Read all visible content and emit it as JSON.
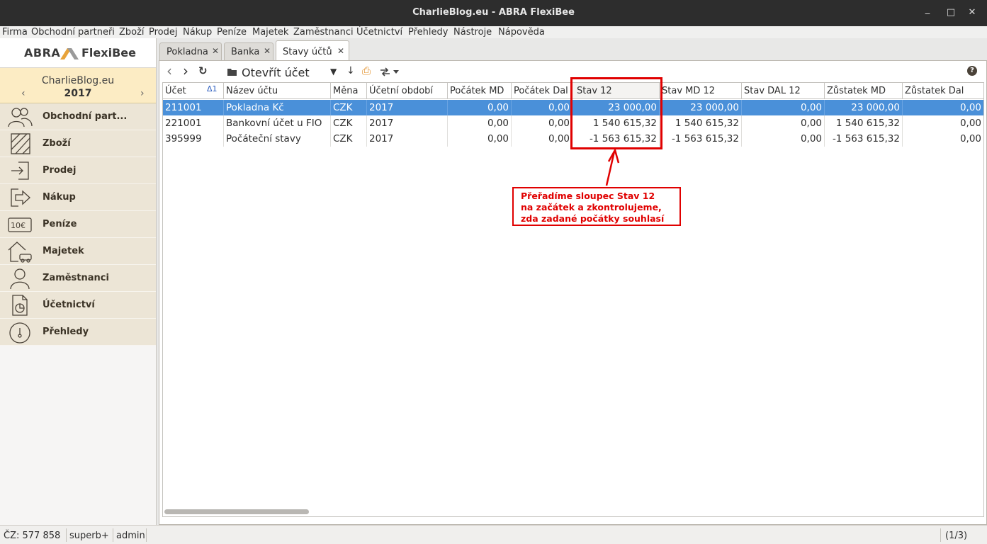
{
  "window": {
    "title": "CharlieBlog.eu - ABRA FlexiBee",
    "minimize_glyph": "_",
    "maximize_glyph": "□",
    "close_glyph": "✕"
  },
  "menu": [
    "Firma",
    "Obchodní partneři",
    "Zboží",
    "Prodej",
    "Nákup",
    "Peníze",
    "Majetek",
    "Zaměstnanci",
    "Účetnictví",
    "Přehledy",
    "Nástroje",
    "Nápověda"
  ],
  "sidebar": {
    "logo_left": "ABRA",
    "logo_right": "FlexiBee",
    "company_name": "CharlieBlog.eu",
    "year": "2017",
    "prev_glyph": "‹",
    "next_glyph": "›",
    "items": [
      {
        "label": "Obchodní part...",
        "icon": "people-icon"
      },
      {
        "label": "Zboží",
        "icon": "goods-icon"
      },
      {
        "label": "Prodej",
        "icon": "sale-icon"
      },
      {
        "label": "Nákup",
        "icon": "purchase-icon"
      },
      {
        "label": "Peníze",
        "icon": "money-icon"
      },
      {
        "label": "Majetek",
        "icon": "property-icon"
      },
      {
        "label": "Zaměstnanci",
        "icon": "employee-icon"
      },
      {
        "label": "Účetnictví",
        "icon": "accounting-icon"
      },
      {
        "label": "Přehledy",
        "icon": "gauge-icon"
      }
    ]
  },
  "tabs": [
    {
      "label": "Pokladna",
      "close": "✕"
    },
    {
      "label": "Banka",
      "close": "✕"
    },
    {
      "label": "Stavy účtů",
      "close": "✕"
    }
  ],
  "toolbar": {
    "open_label": "Otevřít účet",
    "open_icon_glyph": "▰",
    "back_glyph": "‹",
    "forward_glyph": "›",
    "refresh_glyph": "↻",
    "filter_glyph": "▼",
    "sort_glyph": "↓",
    "print_glyph": "⎙",
    "help_glyph": "?"
  },
  "grid": {
    "sort_marker": "Δ1",
    "columns": [
      "Účet",
      "Název účtu",
      "Měna",
      "Účetní období",
      "Počátek MD",
      "Počátek Dal",
      "Stav 12",
      "Stav MD 12",
      "Stav DAL 12",
      "Zůstatek MD",
      "Zůstatek Dal"
    ],
    "rows": [
      {
        "ucet": "211001",
        "nazev": "Pokladna Kč",
        "mena": "CZK",
        "obdobi": "2017",
        "poc_md": "0,00",
        "poc_dal": "0,00",
        "stav12": "23 000,00",
        "stav_md12": "23 000,00",
        "stav_dal12": "0,00",
        "zust_md": "23 000,00",
        "zust_dal": "0,00"
      },
      {
        "ucet": "221001",
        "nazev": "Bankovní účet u FIO",
        "mena": "CZK",
        "obdobi": "2017",
        "poc_md": "0,00",
        "poc_dal": "0,00",
        "stav12": "1 540 615,32",
        "stav_md12": "1 540 615,32",
        "stav_dal12": "0,00",
        "zust_md": "1 540 615,32",
        "zust_dal": "0,00"
      },
      {
        "ucet": "395999",
        "nazev": "Počáteční stavy",
        "mena": "CZK",
        "obdobi": "2017",
        "poc_md": "0,00",
        "poc_dal": "0,00",
        "stav12": "-1 563 615,32",
        "stav_md12": "-1 563 615,32",
        "stav_dal12": "0,00",
        "zust_md": "-1 563 615,32",
        "zust_dal": "0,00"
      }
    ]
  },
  "annotation": {
    "line1": "Přeřadíme sloupec Stav 12",
    "line2": "na začátek a zkontrolujeme,",
    "line3": "zda zadané počátky souhlasí",
    "color": "#e00000"
  },
  "status": {
    "cz": "ČZ: 577 858",
    "db": "superb+",
    "user": "admin",
    "page": "(1/3)"
  }
}
